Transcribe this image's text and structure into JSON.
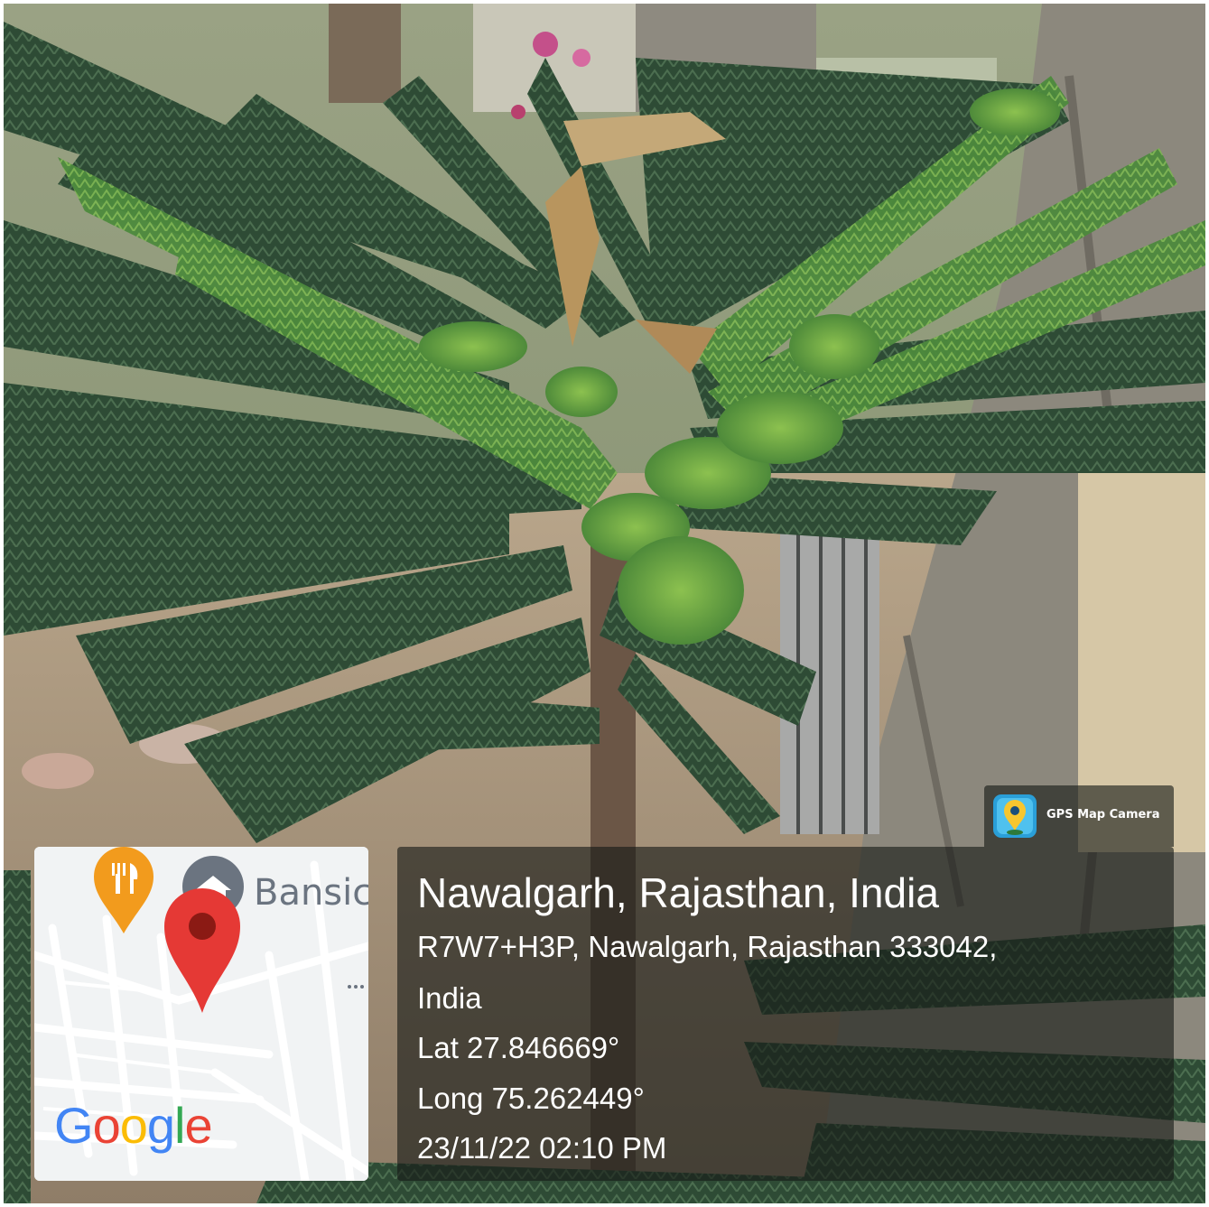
{
  "location": {
    "title": "Nawalgarh, Rajasthan, India",
    "address_line_1": "R7W7+H3P, Nawalgarh, Rajasthan 333042,",
    "address_line_2": "India",
    "latitude": "Lat 27.846669°",
    "longitude": "Long 75.262449°",
    "datetime": "23/11/22 02:10 PM"
  },
  "map": {
    "place_label": "Bansic",
    "logo_text": "Google",
    "logo_colors": [
      "#4285F4",
      "#EA4335",
      "#FBBC05",
      "#4285F4",
      "#34A853",
      "#EA4335"
    ],
    "pin_color": "#E53935",
    "restaurant_marker_color": "#F29B1D",
    "icons": [
      "restaurant-icon",
      "location-pin-icon",
      "place-icon",
      "more-dots-icon"
    ]
  },
  "app_badge": {
    "name": "GPS Map Camera",
    "icon": "gps-camera-app-icon"
  },
  "photo": {
    "subject": "Araucaria branch",
    "colors": {
      "foliage_dark": "#2f4a34",
      "foliage_light": "#7fb24a",
      "trunk": "#8f8a80",
      "ground": "#b8a48a"
    }
  }
}
